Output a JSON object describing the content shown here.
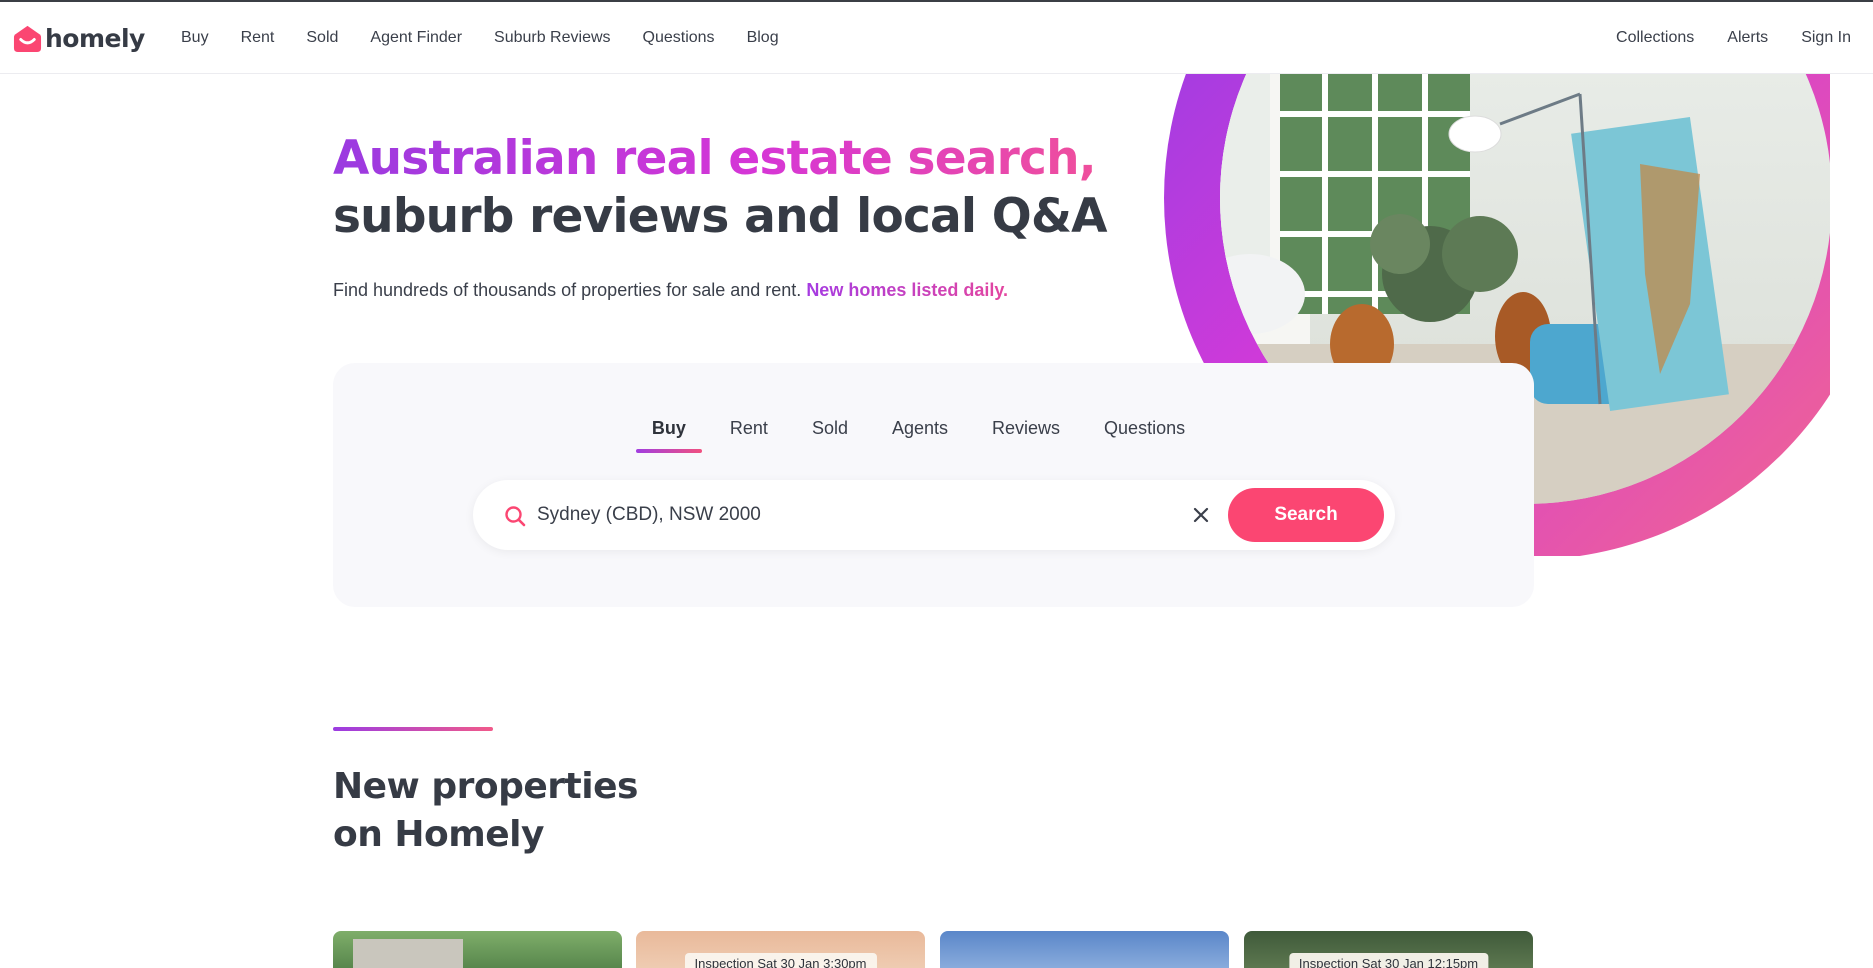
{
  "brand": {
    "name": "homely",
    "accent": "#fb4672",
    "gradient_start": "#9b3ce2",
    "gradient_end": "#f1507f"
  },
  "nav": {
    "left_items": [
      "Buy",
      "Rent",
      "Sold",
      "Agent Finder",
      "Suburb Reviews",
      "Questions",
      "Blog"
    ],
    "right_items": [
      "Collections",
      "Alerts",
      "Sign In"
    ]
  },
  "hero": {
    "title_line1": "Australian real estate search,",
    "title_line2": "suburb reviews and local Q&A",
    "subtitle": "Find hundreds of thousands of properties for sale and rent.",
    "subtitle_highlight": "New homes listed daily."
  },
  "search": {
    "tabs": [
      "Buy",
      "Rent",
      "Sold",
      "Agents",
      "Reviews",
      "Questions"
    ],
    "active_tab": "Buy",
    "input_value": "Sydney (CBD), NSW 2000",
    "button_label": "Search",
    "icons": {
      "search": "search-icon",
      "clear": "close-icon"
    }
  },
  "new_properties": {
    "title_line1": "New properties",
    "title_line2": "on Homely",
    "cards": [
      {
        "badge": ""
      },
      {
        "badge": "Inspection Sat 30 Jan 3:30pm"
      },
      {
        "badge": ""
      },
      {
        "badge": "Inspection Sat 30 Jan 12:15pm"
      }
    ]
  }
}
